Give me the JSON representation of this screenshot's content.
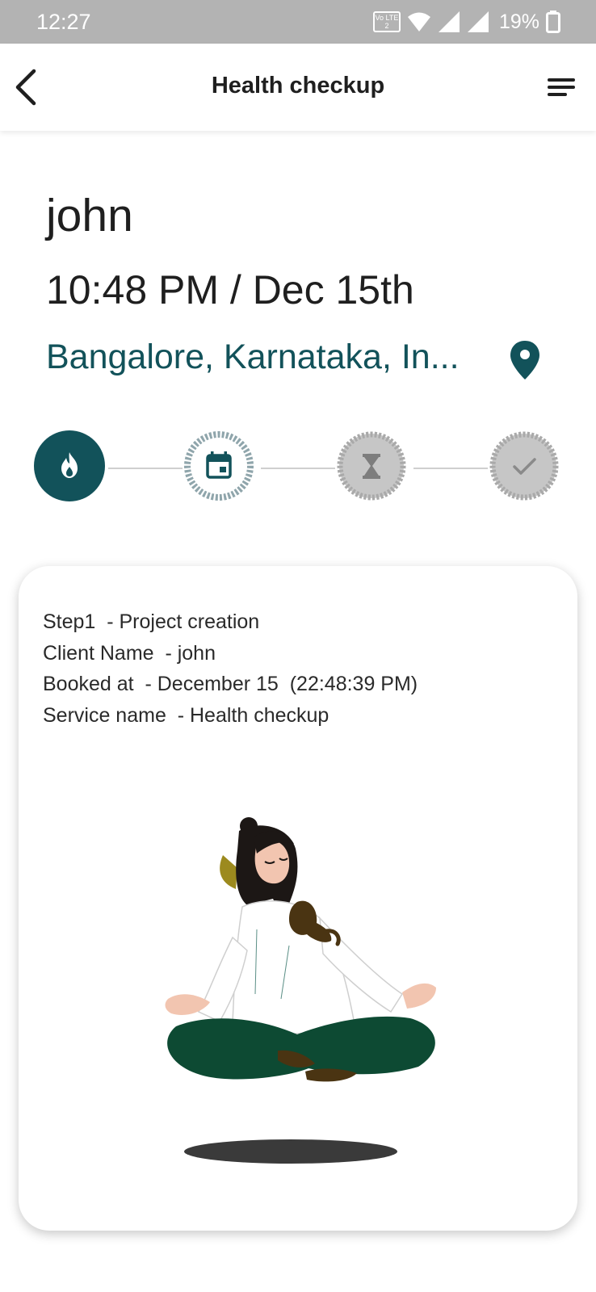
{
  "status_bar": {
    "time": "12:27",
    "volte": "Vo LTE 2",
    "battery": "19%",
    "icons": [
      "wifi-icon",
      "signal-icon",
      "signal-icon",
      "battery-icon"
    ]
  },
  "app_bar": {
    "title": "Health checkup",
    "back_icon": "back-arrow-icon",
    "menu_icon": "menu-icon"
  },
  "header": {
    "client": "john",
    "datetime": "10:48 PM / Dec 15th",
    "location": "Bangalore, Karnataka, In...",
    "location_icon": "location-pin-icon"
  },
  "stepper": {
    "steps": [
      {
        "icon": "fire-icon",
        "state": "active"
      },
      {
        "icon": "calendar-icon",
        "state": "current"
      },
      {
        "icon": "hourglass-icon",
        "state": "pending"
      },
      {
        "icon": "check-icon",
        "state": "pending"
      }
    ]
  },
  "card": {
    "lines": [
      "Step1  - Project creation",
      "Client Name  - john",
      "Booked at  - December 15  (22:48:39 PM)",
      "Service name  - Health checkup"
    ],
    "illustration": "meditating-woman-with-cat"
  },
  "colors": {
    "accent": "#12525a",
    "status_bar": "#b3b3b3",
    "pending": "#c6c6c6"
  }
}
